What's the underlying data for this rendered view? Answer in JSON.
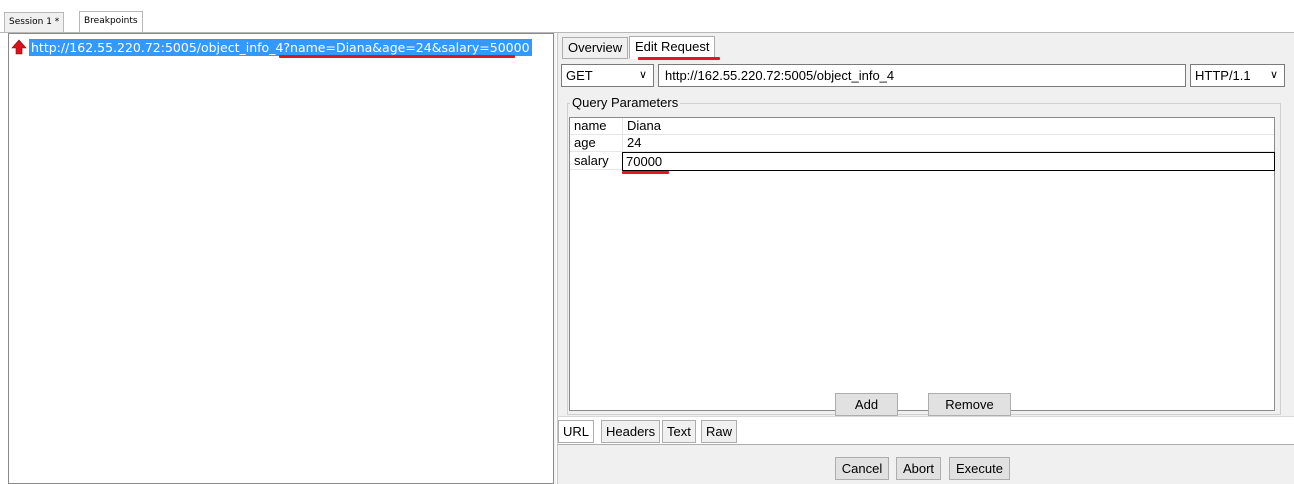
{
  "session_tabs": [
    {
      "label": "Session 1 *"
    },
    {
      "label": "Breakpoints"
    }
  ],
  "breakpoint": {
    "url": "http://162.55.220.72:5005/object_info_4?name=Diana&age=24&salary=50000",
    "icon": "red-up-arrow-icon"
  },
  "request_tabs": [
    {
      "label": "Overview"
    },
    {
      "label": "Edit Request"
    }
  ],
  "method": "GET",
  "request_url": "http://162.55.220.72:5005/object_info_4",
  "http_version": "HTTP/1.1",
  "query_parameters_title": "Query Parameters",
  "query_parameters": [
    {
      "name": "name",
      "value": "Diana"
    },
    {
      "name": "age",
      "value": "24"
    },
    {
      "name": "salary",
      "value": "70000"
    }
  ],
  "buttons": {
    "add": "Add",
    "remove": "Remove",
    "cancel": "Cancel",
    "abort": "Abort",
    "execute": "Execute"
  },
  "view_tabs": [
    {
      "label": "URL"
    },
    {
      "label": "Headers"
    },
    {
      "label": "Text"
    },
    {
      "label": "Raw"
    }
  ],
  "colors": {
    "selection": "#3399ff",
    "annotation_underline": "#e8141b",
    "panel_background": "#f0f0f0"
  }
}
